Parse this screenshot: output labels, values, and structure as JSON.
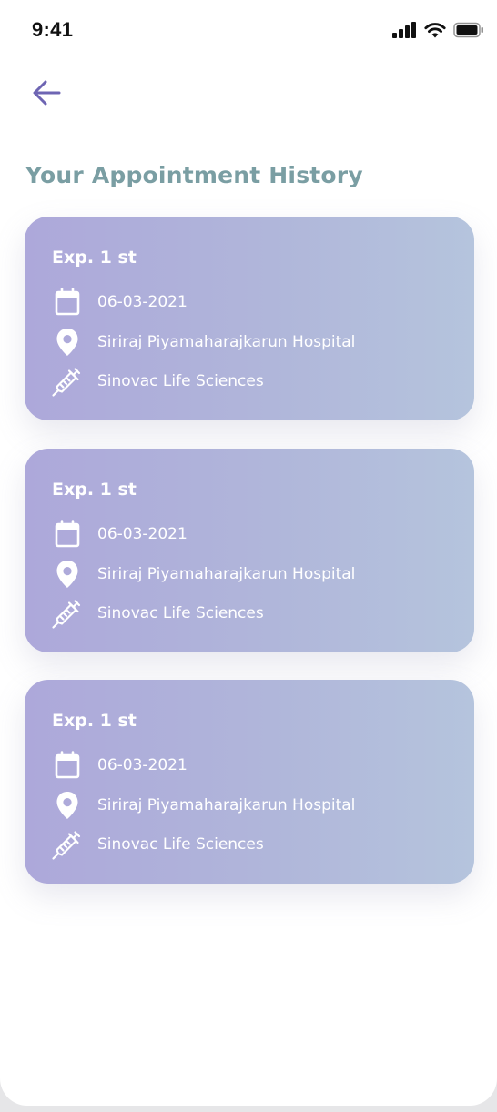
{
  "status_bar": {
    "time": "9:41"
  },
  "header": {
    "title": "Your Appointment History"
  },
  "icons": {
    "back": "arrow-left-icon",
    "date": "calendar-icon",
    "location": "map-pin-icon",
    "vaccine": "syringe-icon"
  },
  "colors": {
    "title": "#7a9ea3",
    "back_arrow": "#6e65b3",
    "card_gradient_start": "#ada8da",
    "card_gradient_end": "#b5c4dd"
  },
  "appointments": [
    {
      "title": "Exp. 1 st",
      "date": "06-03-2021",
      "location": "Siriraj Piyamaharajkarun Hospital",
      "vaccine": "Sinovac Life Sciences"
    },
    {
      "title": "Exp. 1 st",
      "date": "06-03-2021",
      "location": "Siriraj Piyamaharajkarun Hospital",
      "vaccine": "Sinovac Life Sciences"
    },
    {
      "title": "Exp. 1 st",
      "date": "06-03-2021",
      "location": "Siriraj Piyamaharajkarun Hospital",
      "vaccine": "Sinovac Life Sciences"
    }
  ]
}
